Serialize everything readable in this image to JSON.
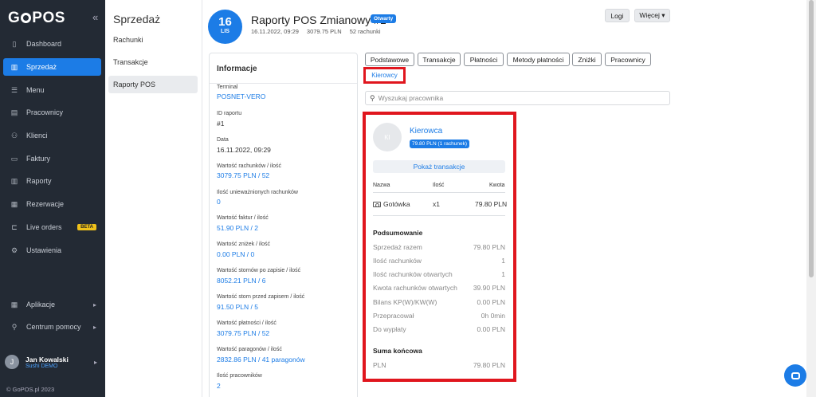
{
  "sidebar": {
    "logo": "GoPOS",
    "collapse_icon": "«",
    "items": [
      {
        "label": "Dashboard",
        "icon": "dashboard-icon",
        "glyph": "▯"
      },
      {
        "label": "Sprzedaż",
        "icon": "sales-icon",
        "glyph": "▥"
      },
      {
        "label": "Menu",
        "icon": "menu-icon",
        "glyph": "☰"
      },
      {
        "label": "Pracownicy",
        "icon": "employees-icon",
        "glyph": "▤"
      },
      {
        "label": "Klienci",
        "icon": "clients-icon",
        "glyph": "⚇"
      },
      {
        "label": "Faktury",
        "icon": "invoices-icon",
        "glyph": "▭"
      },
      {
        "label": "Raporty",
        "icon": "reports-icon",
        "glyph": "▥"
      },
      {
        "label": "Rezerwacje",
        "icon": "reservations-icon",
        "glyph": "▦"
      },
      {
        "label": "Live orders",
        "icon": "live-orders-icon",
        "glyph": "⊏",
        "badge": "BETA"
      },
      {
        "label": "Ustawienia",
        "icon": "settings-icon",
        "glyph": "⚙"
      }
    ],
    "bottom_items": [
      {
        "label": "Aplikacje",
        "icon": "apps-icon",
        "glyph": "▦"
      },
      {
        "label": "Centrum pomocy",
        "icon": "help-icon",
        "glyph": "⚲"
      }
    ],
    "user": {
      "initial": "J",
      "name": "Jan Kowalski",
      "org": "Sushi DEMO"
    },
    "copyright": "© GoPOS.pl 2023"
  },
  "subnav": {
    "title": "Sprzedaż",
    "items": [
      "Rachunki",
      "Transakcje",
      "Raporty POS"
    ]
  },
  "header": {
    "day": "16",
    "month": "LIS",
    "title": "Raporty POS Zmianowy #1",
    "status": "Otwarty",
    "datetime": "16.11.2022, 09:29",
    "amount": "3079.75 PLN",
    "receipts": "52 rachunki",
    "logs_button": "Logi",
    "more_button": "Więcej ▾"
  },
  "info": {
    "heading": "Informacje",
    "rows": [
      {
        "label": "Terminal",
        "value": "POSNET-VERO",
        "link": true
      },
      {
        "label": "ID raportu",
        "value": "#1",
        "link": false
      },
      {
        "label": "Data",
        "value": "16.11.2022, 09:29",
        "link": false
      },
      {
        "label": "Wartość rachunków / ilość",
        "value": "3079.75 PLN / 52",
        "link": true
      },
      {
        "label": "Ilość unieważnionych rachunków",
        "value": "0",
        "link": true
      },
      {
        "label": "Wartość faktur / ilość",
        "value": "51.90 PLN / 2",
        "link": true
      },
      {
        "label": "Wartość zniżek / ilość",
        "value": "0.00 PLN / 0",
        "link": true
      },
      {
        "label": "Wartość stornów po zapisie / ilość",
        "value": "8052.21 PLN / 6",
        "link": true
      },
      {
        "label": "Wartość storn przed zapisem / ilość",
        "value": "91.50 PLN / 5",
        "link": true
      },
      {
        "label": "Wartość płatności / ilość",
        "value": "3079.75 PLN / 52",
        "link": true
      },
      {
        "label": "Wartość paragonów / ilość",
        "value": "2832.86 PLN / 41 paragonów",
        "link": true
      },
      {
        "label": "Ilość pracowników",
        "value": "2",
        "link": true
      }
    ]
  },
  "tabs": [
    "Podstawowe",
    "Transakcje",
    "Płatności",
    "Metody płatności",
    "Zniżki",
    "Pracownicy"
  ],
  "active_tab": "Kierowcy",
  "search": {
    "placeholder": "Wyszukaj pracownika",
    "icon": "search-icon"
  },
  "card": {
    "initials": "KI",
    "name": "Kierowca",
    "badge": "79.80 PLN (1 rachunek)",
    "show_button": "Pokaż transakcje",
    "columns": [
      "Nazwa",
      "Ilość",
      "Kwota"
    ],
    "payment": {
      "name": "Gotówka",
      "qty": "x1",
      "amount": "79.80 PLN"
    },
    "summary_heading": "Podsumowanie",
    "summary": [
      {
        "label": "Sprzedaż razem",
        "value": "79.80 PLN"
      },
      {
        "label": "Ilość rachunków",
        "value": "1"
      },
      {
        "label": "Ilość rachunków otwartych",
        "value": "1"
      },
      {
        "label": "Kwota rachunków otwartych",
        "value": "39.90 PLN"
      },
      {
        "label": "Bilans KP(W)/KW(W)",
        "value": "0.00 PLN"
      },
      {
        "label": "Przepracował",
        "value": "0h 0min"
      },
      {
        "label": "Do wypłaty",
        "value": "0.00 PLN"
      }
    ],
    "total_heading": "Suma końcowa",
    "total": {
      "label": "PLN",
      "value": "79.80 PLN"
    }
  },
  "colors": {
    "accent": "#1c7ce6",
    "sidebar": "#232a34",
    "highlight": "#e0161e",
    "beta": "#f0c21a"
  }
}
